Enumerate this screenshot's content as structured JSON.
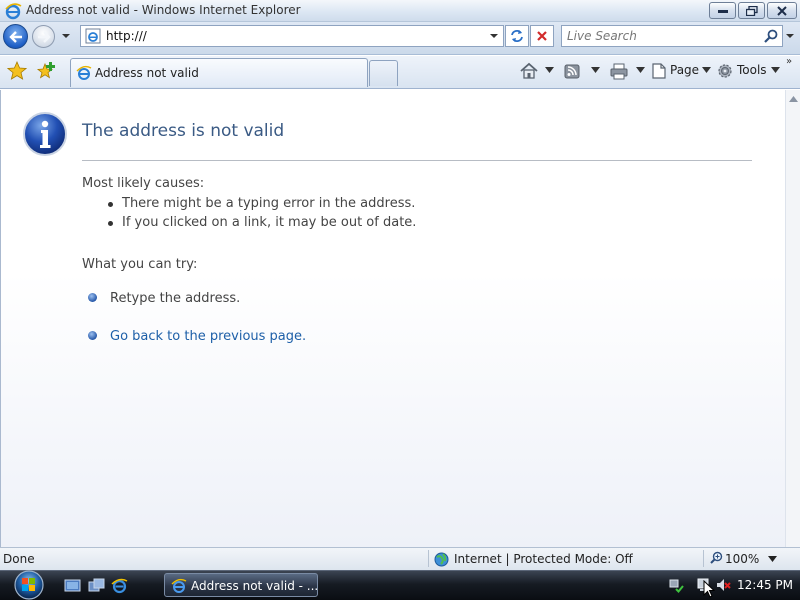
{
  "window": {
    "title": "Address not valid - Windows Internet Explorer"
  },
  "address_bar": {
    "url": "http:///"
  },
  "search": {
    "placeholder": "Live Search"
  },
  "tabs": [
    {
      "label": "Address not valid",
      "active": true
    }
  ],
  "command_bar": {
    "page_label": "Page",
    "tools_label": "Tools",
    "more": "»"
  },
  "content": {
    "title": "The address is not valid",
    "causes_heading": "Most likely causes:",
    "causes": [
      "There might be a typing error in the address.",
      "If you clicked on a link, it may be out of date."
    ],
    "try_heading": "What you can try:",
    "actions": [
      {
        "text": "Retype the address.",
        "link": false
      },
      {
        "text": "Go back to the previous page.",
        "link": true
      }
    ]
  },
  "status_bar": {
    "status": "Done",
    "zone": "Internet | Protected Mode: Off",
    "zoom": "100%"
  },
  "taskbar": {
    "task_label": "Address not valid - ...",
    "clock": "12:45 PM"
  },
  "colors": {
    "title_text": "#3a5a84",
    "link": "#1d5fa8",
    "body_text": "#444444",
    "accent_blue": "#2557a8"
  },
  "icons": {
    "back": "back-arrow-icon",
    "forward": "forward-arrow-icon",
    "refresh": "refresh-icon",
    "stop": "stop-icon",
    "search": "search-icon",
    "favorites": "favorites-star-icon",
    "add_favorite": "add-favorite-icon",
    "home": "home-icon",
    "feeds": "rss-feed-icon",
    "print": "printer-icon",
    "page": "page-icon",
    "tools": "gear-icon",
    "info": "info-icon",
    "globe": "globe-icon",
    "zoom": "zoom-magnifier-icon"
  }
}
